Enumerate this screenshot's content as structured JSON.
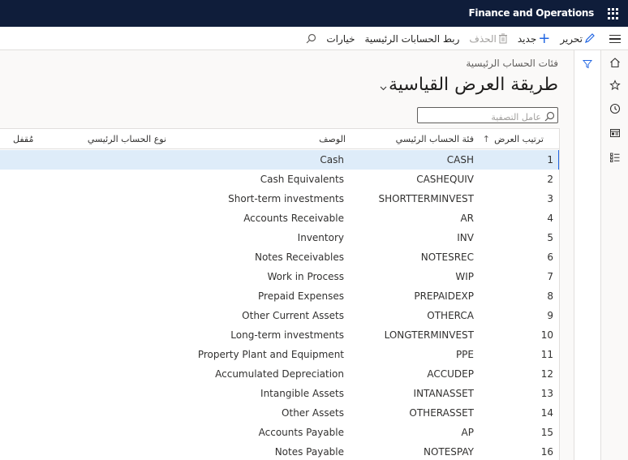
{
  "app": {
    "title": "Finance and Operations"
  },
  "actions": {
    "edit": "تحرير",
    "new": "جديد",
    "delete": "الحذف",
    "link": "ربط الحسابات الرئيسية",
    "options": "خيارات"
  },
  "page": {
    "breadcrumb": "فئات الحساب الرئيسية",
    "title": "طريقة العرض القياسية"
  },
  "filter": {
    "placeholder": "عامل التصفية"
  },
  "grid": {
    "headers": {
      "order": "ترتيب العرض",
      "category": "فئة الحساب الرئيسي",
      "description": "الوصف",
      "type": "نوع الحساب الرئيسي",
      "locked": "مُقفل"
    },
    "rows": [
      {
        "order": "1",
        "category": "CASH",
        "description": "Cash"
      },
      {
        "order": "2",
        "category": "CASHEQUIV",
        "description": "Cash Equivalents"
      },
      {
        "order": "3",
        "category": "SHORTTERMINVEST",
        "description": "Short-term investments"
      },
      {
        "order": "4",
        "category": "AR",
        "description": "Accounts Receivable"
      },
      {
        "order": "5",
        "category": "INV",
        "description": "Inventory"
      },
      {
        "order": "6",
        "category": "NOTESREC",
        "description": "Notes Receivables"
      },
      {
        "order": "7",
        "category": "WIP",
        "description": "Work in Process"
      },
      {
        "order": "8",
        "category": "PREPAIDEXP",
        "description": "Prepaid Expenses"
      },
      {
        "order": "9",
        "category": "OTHERCA",
        "description": "Other Current Assets"
      },
      {
        "order": "10",
        "category": "LONGTERMINVEST",
        "description": "Long-term investments"
      },
      {
        "order": "11",
        "category": "PPE",
        "description": "Property Plant and Equipment"
      },
      {
        "order": "12",
        "category": "ACCUDEP",
        "description": "Accumulated Depreciation"
      },
      {
        "order": "13",
        "category": "INTANASSET",
        "description": "Intangible Assets"
      },
      {
        "order": "14",
        "category": "OTHERASSET",
        "description": "Other Assets"
      },
      {
        "order": "15",
        "category": "AP",
        "description": "Accounts Payable"
      },
      {
        "order": "16",
        "category": "NOTESPAY",
        "description": "Notes Payable"
      }
    ]
  },
  "colors": {
    "topbar": "#0f1d3a",
    "accent": "#2266e3",
    "selected_row": "#deecf9"
  }
}
